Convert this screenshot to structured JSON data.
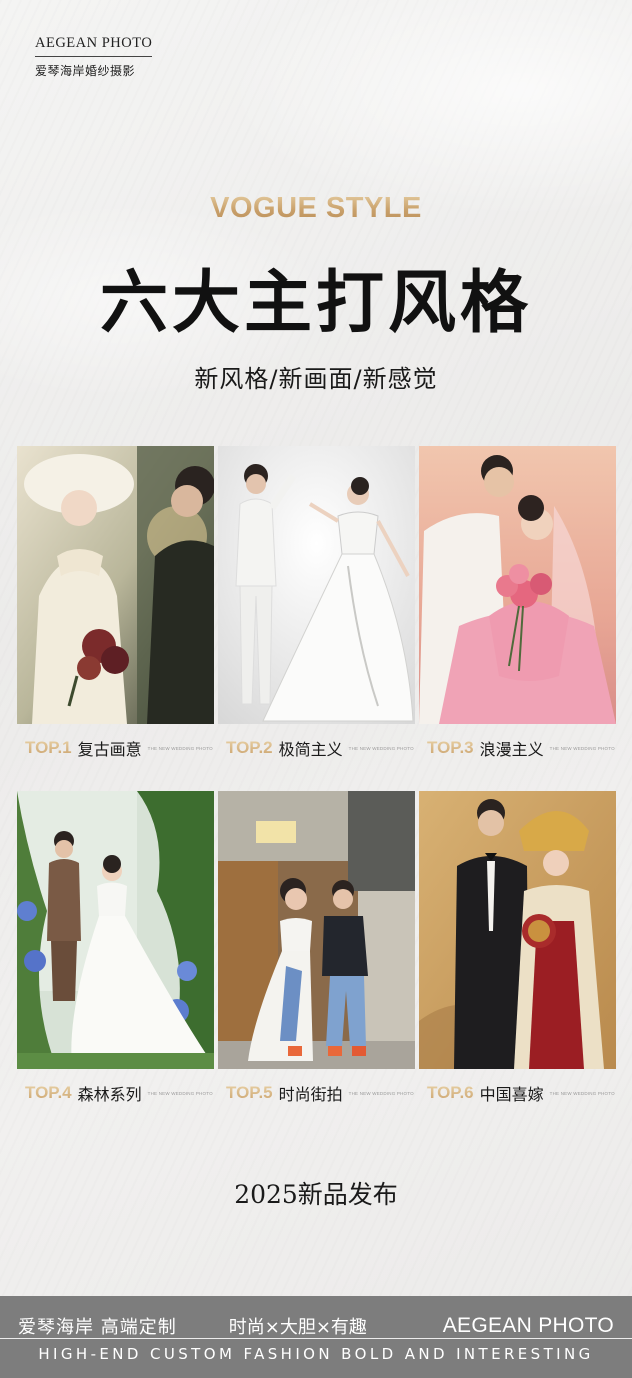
{
  "brand": {
    "en": "AEGEAN PHOTO",
    "cn": "爱琴海岸婚纱摄影"
  },
  "hero": {
    "eyebrow": "VOGUE STYLE",
    "title": "六大主打风格",
    "subtitle": "新风格/新画面/新感觉"
  },
  "styles": [
    {
      "top": "TOP.1",
      "name": "复古画意",
      "tiny": "THE NEW WEDDING PHOTO",
      "image": "vintage-painterly-couple-photo"
    },
    {
      "top": "TOP.2",
      "name": "极简主义",
      "tiny": "THE NEW WEDDING PHOTO",
      "image": "minimalist-white-studio-couple-photo"
    },
    {
      "top": "TOP.3",
      "name": "浪漫主义",
      "tiny": "THE NEW WEDDING PHOTO",
      "image": "romantic-pink-couple-photo"
    },
    {
      "top": "TOP.4",
      "name": "森林系列",
      "tiny": "THE NEW WEDDING PHOTO",
      "image": "forest-garden-couple-photo"
    },
    {
      "top": "TOP.5",
      "name": "时尚街拍",
      "tiny": "THE NEW WEDDING PHOTO",
      "image": "fashion-street-couple-photo"
    },
    {
      "top": "TOP.6",
      "name": "中国喜嫁",
      "tiny": "THE NEW WEDDING PHOTO",
      "image": "chinese-traditional-wedding-photo"
    }
  ],
  "launch": "2025新品发布",
  "footer": {
    "cn_brand": "爱琴海岸 高端定制",
    "cn_tagline": "时尚×大胆×有趣",
    "en_brand": "AEGEAN PHOTO",
    "en_tagline": "HIGH-END CUSTOM FASHION BOLD AND INTERESTING"
  },
  "colors": {
    "gold": "#c9a06a",
    "footer_bg": "#7d7d7d",
    "text": "#1a1a1a"
  }
}
